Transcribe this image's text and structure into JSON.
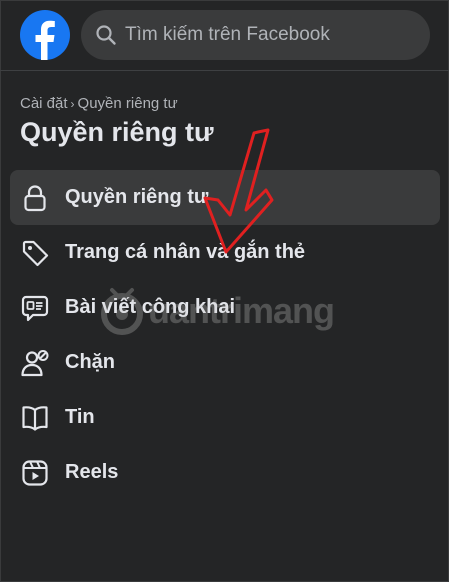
{
  "header": {
    "logo_icon": "facebook-logo-icon",
    "search_icon": "search-icon",
    "search_placeholder": "Tìm kiếm trên Facebook"
  },
  "breadcrumb": {
    "parent": "Cài đặt",
    "separator": "›",
    "current": "Quyền riêng tư"
  },
  "page_title": "Quyền riêng tư",
  "menu": {
    "items": [
      {
        "label": "Quyền riêng tư",
        "icon": "lock-icon",
        "active": true
      },
      {
        "label": "Trang cá nhân và gắn thẻ",
        "icon": "tag-icon",
        "active": false
      },
      {
        "label": "Bài viết công khai",
        "icon": "public-post-icon",
        "active": false
      },
      {
        "label": "Chặn",
        "icon": "block-user-icon",
        "active": false
      },
      {
        "label": "Tin",
        "icon": "book-icon",
        "active": false
      },
      {
        "label": "Reels",
        "icon": "reels-icon",
        "active": false
      }
    ]
  },
  "watermark": {
    "text": "uantrimang",
    "icon": "quantrimang-logo-icon"
  },
  "colors": {
    "background": "#242526",
    "active_item": "#3a3b3c",
    "brand": "#1877f2",
    "arrow": "#e02020"
  }
}
